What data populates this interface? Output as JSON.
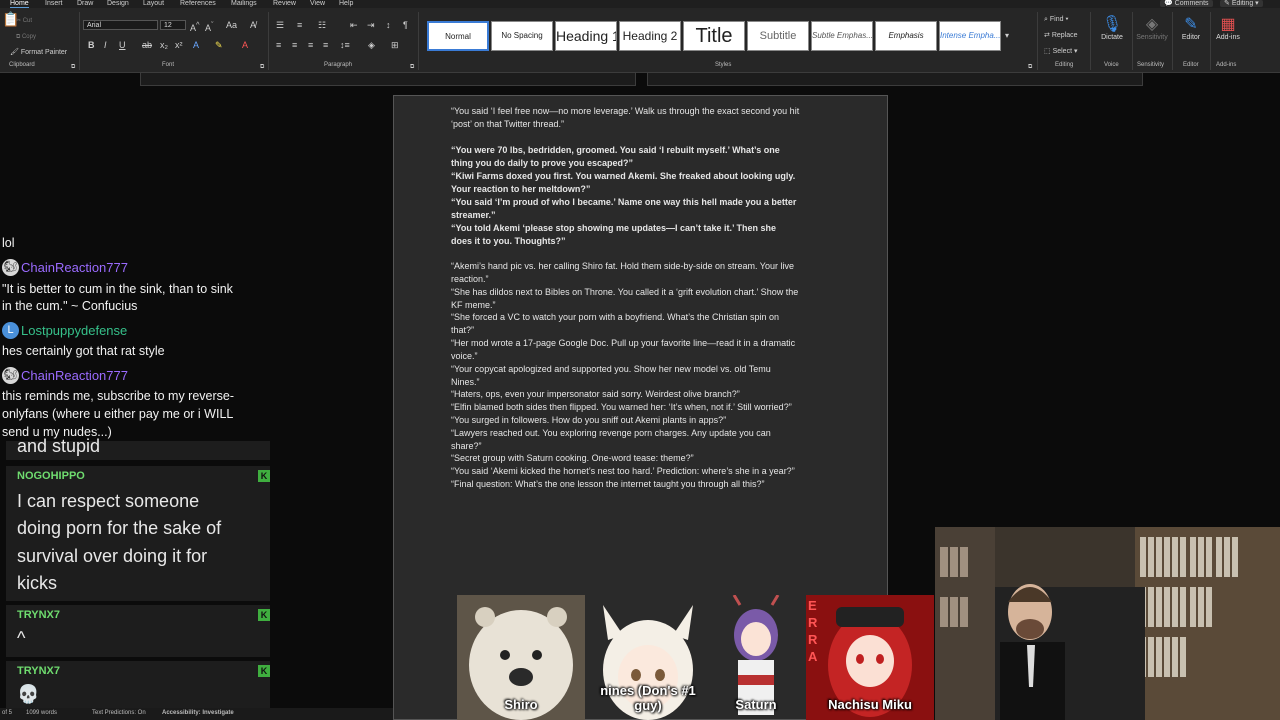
{
  "ribbon": {
    "tabs": [
      "Home",
      "Insert",
      "Draw",
      "Design",
      "Layout",
      "References",
      "Mailings",
      "Review",
      "View",
      "Help"
    ],
    "right_buttons": [
      "Comments",
      "Editing"
    ],
    "clipboard": {
      "cut": "Cut",
      "copy": "Copy",
      "format_painter": "Format Painter",
      "label": "Clipboard"
    },
    "font": {
      "name": "Arial",
      "size": "12",
      "label": "Font"
    },
    "paragraph_label": "Paragraph",
    "styles": [
      "Normal",
      "No Spacing",
      "Heading 1",
      "Heading 2",
      "Title",
      "Subtitle",
      "Subtle Emphas...",
      "Emphasis",
      "Intense Empha..."
    ],
    "styles_label": "Styles",
    "editing": {
      "find": "Find",
      "replace": "Replace",
      "select": "Select",
      "label": "Editing"
    },
    "voice": {
      "dictate": "Dictate",
      "label": "Voice"
    },
    "sensitivity": {
      "button": "Sensitivity",
      "label": "Sensitivity"
    },
    "editor": {
      "button": "Editor",
      "label": "Editor"
    },
    "addins": {
      "button": "Add-ins",
      "label": "Add-ins"
    }
  },
  "document": {
    "lines": [
      {
        "text": "“You said ‘I feel free now—no more leverage.’ Walk us through the exact second you hit",
        "bold": false
      },
      {
        "text": "‘post’ on that Twitter thread.”",
        "bold": false
      },
      {
        "text": "",
        "bold": false
      },
      {
        "text": " “You were 70 lbs, bedridden, groomed. You said ‘I rebuilt myself.’ What’s one",
        "bold": true
      },
      {
        "text": "thing you do daily to prove you escaped?”",
        "bold": true
      },
      {
        "text": " “Kiwi Farms doxed you first. You warned Akemi. She freaked about looking ugly.",
        "bold": true
      },
      {
        "text": "Your reaction to her meltdown?”",
        "bold": true
      },
      {
        "text": " “You said ‘I’m proud of who I became.’ Name one way this hell made you a better",
        "bold": true
      },
      {
        "text": "streamer.”",
        "bold": true
      },
      {
        "text": " “You told Akemi ‘please stop showing me updates—I can’t take it.’ Then she",
        "bold": true
      },
      {
        "text": "does it to you. Thoughts?”",
        "bold": true
      },
      {
        "text": "",
        "bold": false
      },
      {
        "text": "“Akemi’s hand pic vs. her calling Shiro fat. Hold them side-by-side on stream. Your live",
        "bold": false
      },
      {
        "text": "reaction.”",
        "bold": false
      },
      {
        "text": "“She has dildos next to Bibles on Throne. You called it a ‘grift evolution chart.’ Show the",
        "bold": false
      },
      {
        "text": "KF meme.”",
        "bold": false
      },
      {
        "text": "“She forced a VC to watch your porn with a boyfriend. What’s the Christian spin on",
        "bold": false
      },
      {
        "text": "that?”",
        "bold": false
      },
      {
        "text": "“Her mod wrote a 17-page Google Doc. Pull up your favorite line—read it in a dramatic",
        "bold": false
      },
      {
        "text": "voice.”",
        "bold": false
      },
      {
        "text": "“Your copycat apologized and supported you. Show her new model vs. old Temu",
        "bold": false
      },
      {
        "text": "Nines.”",
        "bold": false
      },
      {
        "text": "“Haters, ops, even your impersonator said sorry. Weirdest olive branch?”",
        "bold": false
      },
      {
        "text": "“Elfin blamed both sides then flipped. You warned her: ‘It’s when, not if.’ Still worried?”",
        "bold": false
      },
      {
        "text": "“You surged in followers. How do you sniff out Akemi plants in apps?”",
        "bold": false
      },
      {
        "text": "“Lawyers reached out. You exploring revenge porn charges. Any update you can",
        "bold": false
      },
      {
        "text": "share?”",
        "bold": false
      },
      {
        "text": "“Secret group with Saturn cooking. One-word tease: theme?”",
        "bold": false
      },
      {
        "text": "“You said ‘Akemi kicked the hornet’s nest too hard.’ Prediction: where’s she in a year?”",
        "bold": false
      },
      {
        "text": "“Final question: What’s the one lesson the internet taught you through all this?”",
        "bold": false
      }
    ]
  },
  "chat_overlay": {
    "messages": [
      {
        "user": "",
        "text": "lol"
      },
      {
        "user": "ChainReaction777",
        "text": "\"It is better to cum in the sink, than to sink"
      },
      {
        "user": "",
        "text": "in the cum.\" ~ Confucius"
      },
      {
        "user": "Lostpuppydefense",
        "text": "hes certainly got that rat style"
      },
      {
        "user": "ChainReaction777",
        "text": "this reminds me, subscribe to my reverse-"
      },
      {
        "user": "",
        "text": "onlyfans (where u either pay me or i WILL"
      },
      {
        "user": "",
        "text": "send u my nudes...)"
      }
    ],
    "colors": {
      "chainreaction": "#9b6bff",
      "lostpuppy": "#36c08a"
    }
  },
  "chat_panel": {
    "partial_text": "and stupid",
    "messages": [
      {
        "user": "NOGOHIPPO",
        "lines": [
          "I can respect someone",
          "doing porn for the sake of",
          "survival over doing it for",
          "kicks"
        ]
      },
      {
        "user": "TRYNX7",
        "lines": [
          "^"
        ]
      },
      {
        "user": "TRYNX7",
        "lines": [
          "💀"
        ]
      }
    ],
    "badge": "K"
  },
  "statusbar": {
    "page": "of 5",
    "words": "1099 words",
    "predictions": "Text Predictions: On",
    "accessibility": "Accessibility: Investigate"
  },
  "avatars": [
    {
      "name": "Shiro"
    },
    {
      "name": "nines (Don's #1"
    },
    {
      "name": "Saturn"
    },
    {
      "name": "Nachisu Miku"
    }
  ],
  "avatar_extra": "guy)",
  "banner_text": "ERRA"
}
